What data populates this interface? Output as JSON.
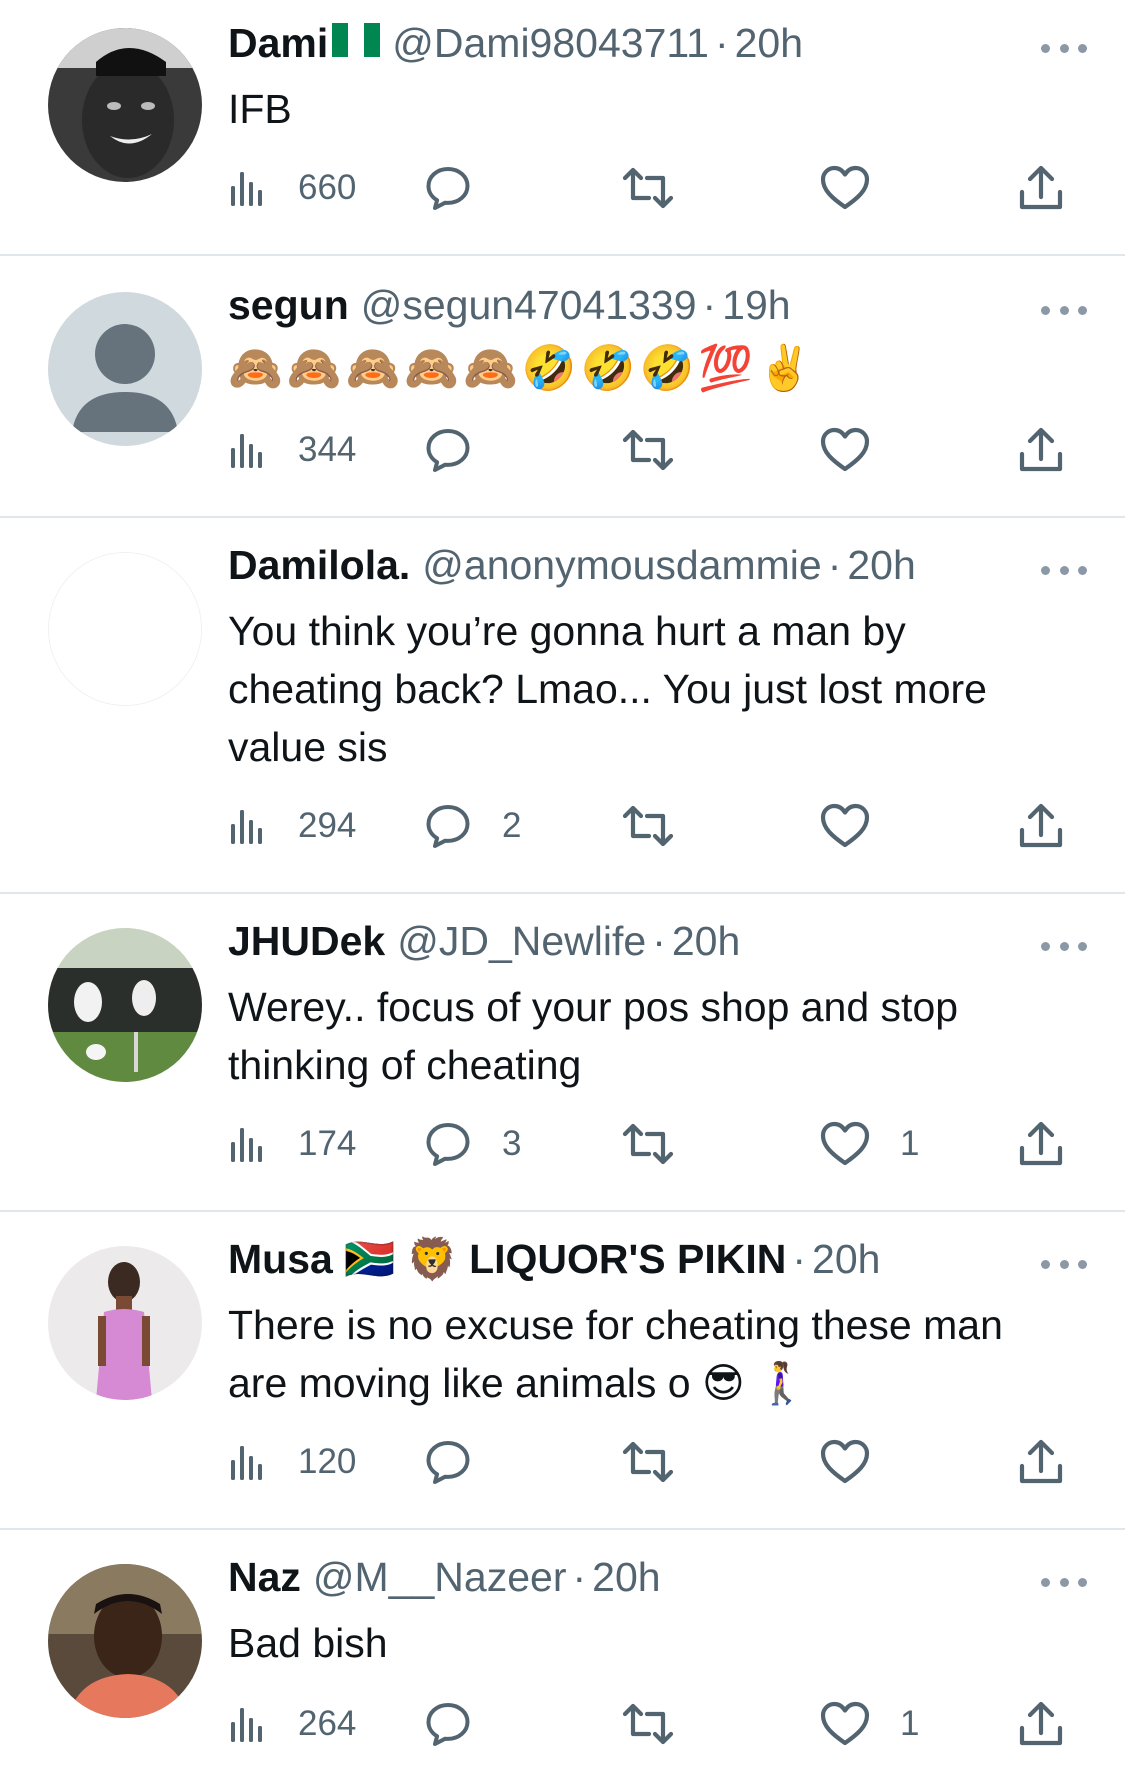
{
  "tweets": [
    {
      "name": "Dami",
      "name_flag": "nigeria-flag",
      "handle": "@Dami98043711",
      "time": "20h",
      "text": "IFB",
      "views": "660",
      "replies": "",
      "retweets": "",
      "likes": ""
    },
    {
      "name": "segun",
      "handle": "@segun47041339",
      "time": "19h",
      "text": "🙈🙈🙈🙈🙈🤣🤣🤣💯✌️",
      "views": "344",
      "replies": "",
      "retweets": "",
      "likes": ""
    },
    {
      "name": "Damilola.",
      "handle": "@anonymousdammie",
      "time": "20h",
      "text": "You think you’re gonna hurt a man by cheating back? Lmao... You just lost more value sis",
      "views": "294",
      "replies": "2",
      "retweets": "",
      "likes": ""
    },
    {
      "name": "JHUDek",
      "handle": "@JD_Newlife",
      "time": "20h",
      "text": "Werey.. focus of your pos shop and stop thinking of cheating",
      "views": "174",
      "replies": "3",
      "retweets": "",
      "likes": "1"
    },
    {
      "name": "Musa 🇿🇦 🦁 LIQUOR'S PIKIN",
      "handle": "",
      "time": "20h",
      "text": "There is no excuse for cheating these man are moving like animals o 😎 🚶‍♀️",
      "views": "120",
      "replies": "",
      "retweets": "",
      "likes": ""
    },
    {
      "name": "Naz",
      "handle": "@M__Nazeer",
      "time": "20h",
      "text": "Bad bish",
      "views": "264",
      "replies": "",
      "retweets": "",
      "likes": "1"
    }
  ],
  "separator": "·",
  "icons": {
    "views": "views-chart-icon",
    "reply": "reply-bubble-icon",
    "retweet": "retweet-icon",
    "like": "heart-icon",
    "share": "share-upload-icon",
    "more": "more-dots-icon"
  },
  "colors": {
    "text": "#0f1419",
    "secondary": "#536471",
    "divider": "#e1e6ea"
  }
}
